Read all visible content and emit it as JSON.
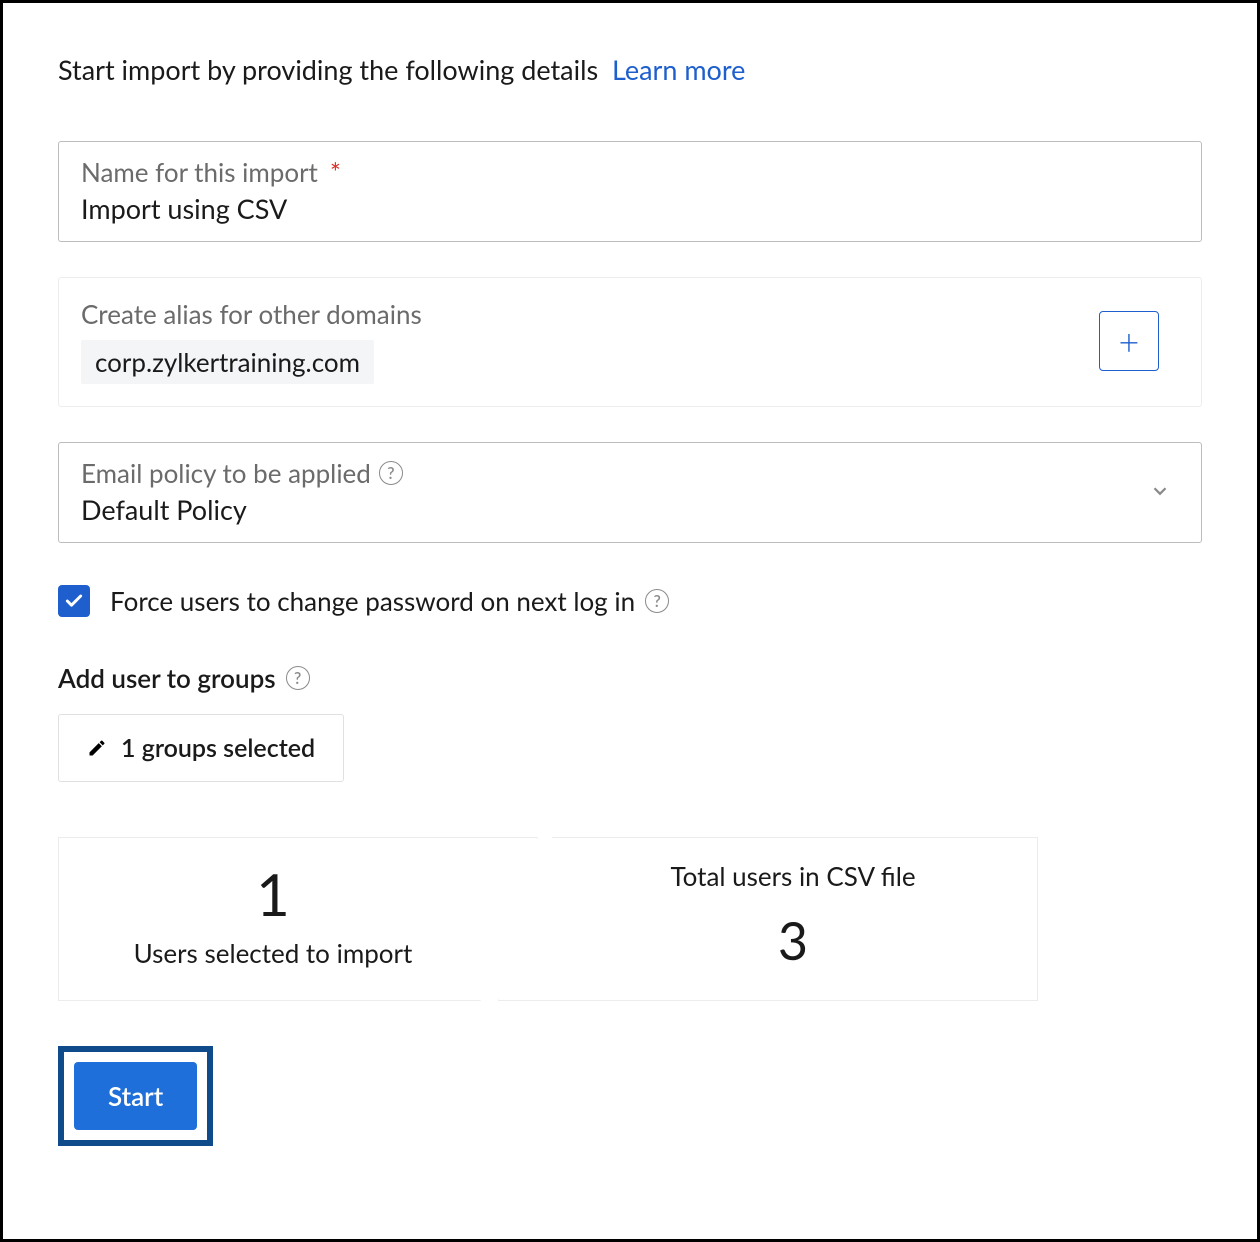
{
  "intro": {
    "text": "Start import by providing the following details",
    "link": "Learn more"
  },
  "name_field": {
    "label": "Name for this import",
    "value": "Import using CSV"
  },
  "alias": {
    "label": "Create alias for other domains",
    "domain": "corp.zylkertraining.com"
  },
  "policy": {
    "label": "Email policy to be applied",
    "value": "Default Policy"
  },
  "force_pw": {
    "label": "Force users to change password on next log in",
    "checked": true
  },
  "groups": {
    "title": "Add user to groups",
    "button": "1 groups selected"
  },
  "stats": {
    "selected_count": "1",
    "selected_label": "Users selected to import",
    "total_label": "Total users in CSV file",
    "total_count": "3"
  },
  "start_label": "Start"
}
